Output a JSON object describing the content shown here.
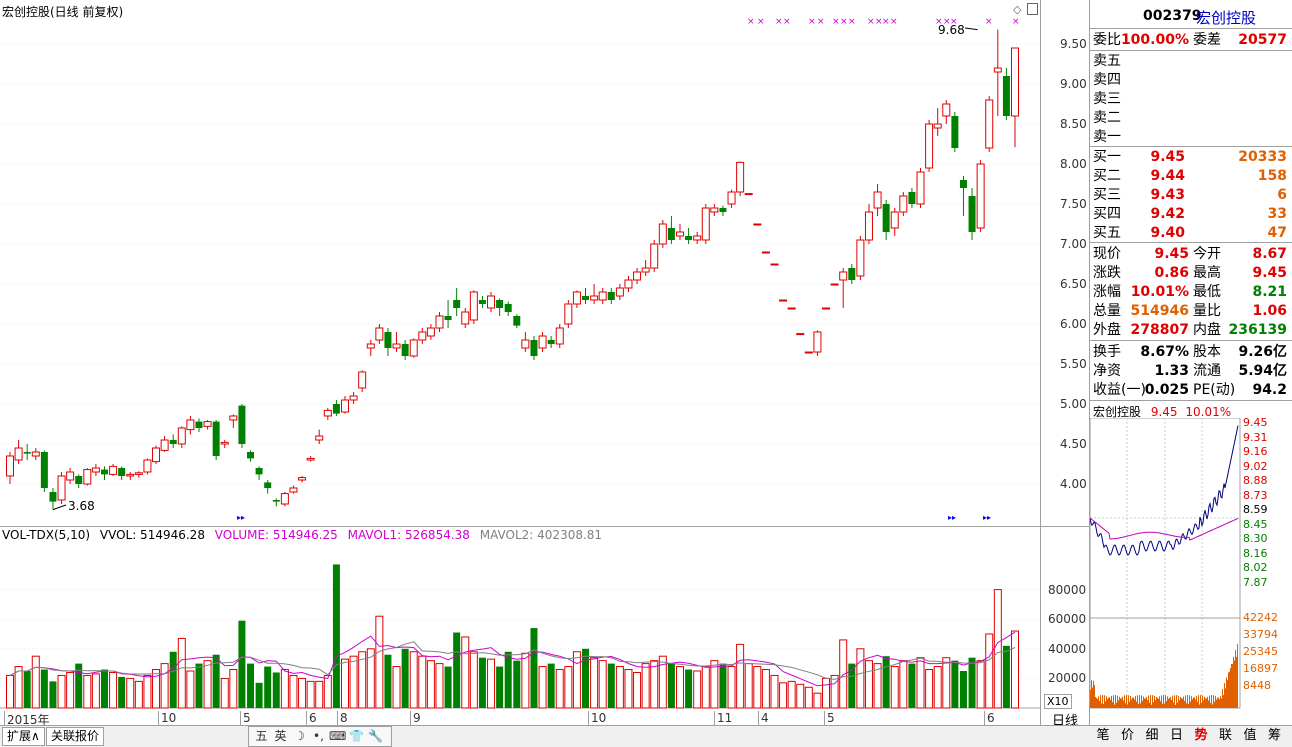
{
  "chart": {
    "title": "宏创控股(日线 前复权)",
    "high_label": "9.68",
    "low_label": "3.68",
    "price_axis": [
      "9.50",
      "9.00",
      "8.50",
      "8.00",
      "7.50",
      "7.00",
      "6.50",
      "6.00",
      "5.50",
      "5.00",
      "4.50",
      "4.00"
    ],
    "vol_axis": [
      "80000",
      "60000",
      "40000",
      "20000"
    ],
    "vol_unit": "X10",
    "period_label": "日线",
    "x_labels": [
      "2015年",
      "10",
      "5",
      "6",
      "8",
      "9",
      "10",
      "11",
      "4",
      "5",
      "6"
    ],
    "indicator": {
      "name": "VOL-TDX(5,10)",
      "vvol": "VVOL: 514946.28",
      "volume": "VOLUME: 514946.25",
      "mavol1": "MAVOL1: 526854.38",
      "mavol2": "MAVOL2: 402308.81"
    }
  },
  "chart_data": {
    "type": "candlestick",
    "y_range": [
      3.55,
      9.8
    ],
    "candles": [
      [
        4.1,
        4.35,
        4.0,
        4.4
      ],
      [
        4.3,
        4.45,
        4.25,
        4.55
      ],
      [
        4.4,
        4.38,
        4.3,
        4.5
      ],
      [
        4.35,
        4.4,
        4.3,
        4.45
      ],
      [
        4.4,
        3.95,
        3.9,
        4.42
      ],
      [
        3.9,
        3.78,
        3.68,
        3.95
      ],
      [
        3.8,
        4.1,
        3.75,
        4.15
      ],
      [
        4.05,
        4.15,
        4.0,
        4.2
      ],
      [
        4.1,
        4.0,
        3.95,
        4.12
      ],
      [
        4.0,
        4.18,
        3.98,
        4.2
      ],
      [
        4.15,
        4.2,
        4.1,
        4.25
      ],
      [
        4.18,
        4.12,
        4.05,
        4.22
      ],
      [
        4.12,
        4.22,
        4.1,
        4.25
      ],
      [
        4.2,
        4.1,
        4.05,
        4.22
      ],
      [
        4.1,
        4.12,
        4.05,
        4.15
      ],
      [
        4.12,
        4.14,
        4.08,
        4.16
      ],
      [
        4.15,
        4.3,
        4.12,
        4.32
      ],
      [
        4.28,
        4.45,
        4.25,
        4.48
      ],
      [
        4.42,
        4.55,
        4.4,
        4.6
      ],
      [
        4.55,
        4.5,
        4.45,
        4.62
      ],
      [
        4.5,
        4.7,
        4.45,
        4.72
      ],
      [
        4.68,
        4.8,
        4.62,
        4.85
      ],
      [
        4.78,
        4.7,
        4.65,
        4.82
      ],
      [
        4.72,
        4.78,
        4.68,
        4.8
      ],
      [
        4.78,
        4.35,
        4.3,
        4.8
      ],
      [
        4.5,
        4.52,
        4.45,
        4.55
      ],
      [
        4.8,
        4.85,
        4.7,
        4.87
      ],
      [
        4.98,
        4.5,
        4.45,
        5.0
      ],
      [
        4.4,
        4.32,
        4.28,
        4.42
      ],
      [
        4.2,
        4.12,
        4.05,
        4.22
      ],
      [
        4.02,
        3.95,
        3.88,
        4.05
      ],
      [
        3.8,
        3.78,
        3.72,
        3.82
      ],
      [
        3.75,
        3.88,
        3.72,
        3.9
      ],
      [
        3.9,
        3.95,
        3.88,
        3.98
      ],
      [
        4.05,
        4.08,
        4.02,
        4.1
      ],
      [
        4.3,
        4.32,
        4.28,
        4.35
      ],
      [
        4.55,
        4.6,
        4.5,
        4.68
      ],
      [
        4.85,
        4.92,
        4.8,
        4.95
      ],
      [
        5.0,
        4.88,
        4.85,
        5.05
      ],
      [
        4.9,
        5.05,
        4.88,
        5.1
      ],
      [
        5.05,
        5.1,
        5.0,
        5.15
      ],
      [
        5.2,
        5.4,
        5.15,
        5.42
      ],
      [
        5.7,
        5.75,
        5.6,
        5.8
      ],
      [
        5.8,
        5.95,
        5.75,
        6.0
      ],
      [
        5.9,
        5.7,
        5.6,
        5.95
      ],
      [
        5.7,
        5.75,
        5.65,
        5.9
      ],
      [
        5.75,
        5.6,
        5.55,
        5.8
      ],
      [
        5.6,
        5.8,
        5.58,
        5.82
      ],
      [
        5.8,
        5.9,
        5.75,
        5.95
      ],
      [
        5.85,
        5.95,
        5.8,
        6.0
      ],
      [
        5.95,
        6.1,
        5.9,
        6.15
      ],
      [
        6.1,
        6.05,
        5.95,
        6.3
      ],
      [
        6.3,
        6.2,
        6.1,
        6.45
      ],
      [
        6.0,
        6.15,
        5.95,
        6.2
      ],
      [
        6.05,
        6.4,
        6.0,
        6.42
      ],
      [
        6.3,
        6.25,
        6.2,
        6.35
      ],
      [
        6.2,
        6.35,
        6.15,
        6.4
      ],
      [
        6.3,
        6.2,
        6.1,
        6.32
      ],
      [
        6.25,
        6.15,
        6.1,
        6.28
      ],
      [
        6.1,
        5.98,
        5.95,
        6.12
      ],
      [
        5.7,
        5.8,
        5.65,
        5.9
      ],
      [
        5.8,
        5.6,
        5.55,
        5.85
      ],
      [
        5.7,
        5.85,
        5.65,
        5.9
      ],
      [
        5.8,
        5.75,
        5.7,
        5.85
      ],
      [
        5.75,
        5.95,
        5.7,
        6.0
      ],
      [
        6.0,
        6.25,
        5.95,
        6.3
      ],
      [
        6.25,
        6.4,
        6.2,
        6.42
      ],
      [
        6.35,
        6.3,
        6.25,
        6.45
      ],
      [
        6.3,
        6.35,
        6.25,
        6.5
      ],
      [
        6.3,
        6.4,
        6.25,
        6.45
      ],
      [
        6.4,
        6.3,
        6.25,
        6.45
      ],
      [
        6.35,
        6.45,
        6.3,
        6.5
      ],
      [
        6.45,
        6.55,
        6.4,
        6.6
      ],
      [
        6.55,
        6.65,
        6.5,
        6.7
      ],
      [
        6.65,
        6.7,
        6.6,
        6.8
      ],
      [
        6.7,
        7.0,
        6.65,
        7.05
      ],
      [
        7.0,
        7.25,
        6.95,
        7.3
      ],
      [
        7.2,
        7.05,
        7.0,
        7.35
      ],
      [
        7.1,
        7.15,
        7.05,
        7.25
      ],
      [
        7.1,
        7.05,
        7.0,
        7.2
      ],
      [
        7.05,
        7.1,
        7.0,
        7.15
      ],
      [
        7.05,
        7.45,
        7.0,
        7.5
      ],
      [
        7.4,
        7.45,
        7.35,
        7.5
      ],
      [
        7.45,
        7.4,
        7.35,
        7.48
      ],
      [
        7.5,
        7.65,
        7.45,
        7.68
      ],
      [
        7.65,
        8.02,
        7.6,
        8.03
      ],
      [
        7.63,
        7.63,
        7.63,
        7.63
      ],
      [
        7.25,
        7.25,
        7.25,
        7.25
      ],
      [
        6.9,
        6.9,
        6.9,
        6.9
      ],
      [
        6.75,
        6.75,
        6.75,
        6.75
      ],
      [
        6.3,
        6.3,
        6.3,
        6.3
      ],
      [
        6.2,
        6.2,
        6.2,
        6.2
      ],
      [
        5.88,
        5.88,
        5.88,
        5.88
      ],
      [
        5.65,
        5.65,
        5.65,
        5.65
      ],
      [
        5.65,
        5.9,
        5.6,
        5.92
      ],
      [
        6.2,
        6.2,
        6.2,
        6.2
      ],
      [
        6.5,
        6.5,
        6.5,
        6.5
      ],
      [
        6.55,
        6.65,
        6.2,
        6.7
      ],
      [
        6.7,
        6.55,
        6.5,
        6.75
      ],
      [
        6.6,
        7.05,
        6.55,
        7.1
      ],
      [
        7.05,
        7.4,
        7.0,
        7.5
      ],
      [
        7.45,
        7.65,
        7.35,
        7.75
      ],
      [
        7.5,
        7.15,
        7.05,
        7.55
      ],
      [
        7.2,
        7.4,
        7.1,
        7.45
      ],
      [
        7.4,
        7.6,
        7.35,
        7.65
      ],
      [
        7.65,
        7.5,
        7.45,
        7.7
      ],
      [
        7.5,
        7.9,
        7.45,
        7.95
      ],
      [
        7.95,
        8.5,
        7.9,
        8.55
      ],
      [
        8.45,
        8.5,
        8.35,
        8.7
      ],
      [
        8.6,
        8.75,
        8.5,
        8.8
      ],
      [
        8.6,
        8.2,
        8.15,
        8.65
      ],
      [
        7.8,
        7.7,
        7.35,
        7.85
      ],
      [
        7.6,
        7.15,
        7.05,
        7.7
      ],
      [
        7.2,
        8.0,
        7.15,
        8.05
      ],
      [
        8.2,
        8.8,
        8.15,
        8.85
      ],
      [
        9.15,
        9.2,
        8.6,
        9.68
      ],
      [
        9.1,
        8.6,
        8.55,
        9.2
      ],
      [
        8.6,
        9.45,
        8.21,
        9.45
      ]
    ],
    "volume": [
      22000,
      28000,
      25000,
      35000,
      26000,
      18000,
      22000,
      24000,
      30000,
      22000,
      23000,
      26000,
      24000,
      21000,
      20000,
      18000,
      22000,
      26000,
      30000,
      38000,
      47000,
      25000,
      30000,
      32000,
      36000,
      20000,
      26000,
      59000,
      30000,
      17000,
      28000,
      24000,
      26000,
      22000,
      20000,
      18000,
      18000,
      22000,
      97000,
      33000,
      35000,
      38000,
      40000,
      62000,
      36000,
      28000,
      40000,
      38000,
      35000,
      32000,
      30000,
      28000,
      51000,
      48000,
      38000,
      34000,
      33000,
      28000,
      38000,
      32000,
      37000,
      54000,
      28000,
      30000,
      26000,
      28000,
      38000,
      40000,
      34000,
      32000,
      30000,
      28000,
      26000,
      24000,
      30000,
      32000,
      35000,
      30000,
      28000,
      26000,
      25000,
      28000,
      32000,
      30000,
      28000,
      43000,
      30000,
      28000,
      26000,
      22000,
      17000,
      18000,
      16000,
      14000,
      10000,
      20000,
      22000,
      46000,
      30000,
      40000,
      32000,
      30000,
      35000,
      28000,
      32000,
      30000,
      34000,
      26000,
      28000,
      34000,
      32000,
      25000,
      34000,
      32000,
      50000,
      80000,
      42000,
      52000
    ]
  },
  "quote": {
    "code": "002379",
    "name": "宏创控股",
    "weibi_label": "委比",
    "weibi_value": "100.00%",
    "weicha_label": "委差",
    "weicha_value": "20577",
    "sell": [
      {
        "label": "卖五",
        "price": "",
        "vol": ""
      },
      {
        "label": "卖四",
        "price": "",
        "vol": ""
      },
      {
        "label": "卖三",
        "price": "",
        "vol": ""
      },
      {
        "label": "卖二",
        "price": "",
        "vol": ""
      },
      {
        "label": "卖一",
        "price": "",
        "vol": ""
      }
    ],
    "buy": [
      {
        "label": "买一",
        "price": "9.45",
        "vol": "20333"
      },
      {
        "label": "买二",
        "price": "9.44",
        "vol": "158"
      },
      {
        "label": "买三",
        "price": "9.43",
        "vol": "6"
      },
      {
        "label": "买四",
        "price": "9.42",
        "vol": "33"
      },
      {
        "label": "买五",
        "price": "9.40",
        "vol": "47"
      }
    ],
    "stats": [
      {
        "l1": "现价",
        "v1": "9.45",
        "l2": "今开",
        "v2": "8.67"
      },
      {
        "l1": "涨跌",
        "v1": "0.86",
        "l2": "最高",
        "v2": "9.45"
      },
      {
        "l1": "涨幅",
        "v1": "10.01%",
        "l2": "最低",
        "v2": "8.21"
      },
      {
        "l1": "总量",
        "v1": "514946",
        "l2": "量比",
        "v2": "1.06"
      },
      {
        "l1": "外盘",
        "v1": "278807",
        "l2": "内盘",
        "v2": "236139"
      }
    ],
    "fund": [
      {
        "l1": "换手",
        "v1": "8.67%",
        "l2": "股本",
        "v2": "9.26亿"
      },
      {
        "l1": "净资",
        "v1": "1.33",
        "l2": "流通",
        "v2": "5.94亿"
      },
      {
        "l1": "收益(一)",
        "v1": "0.025",
        "l2": "PE(动)",
        "v2": "94.2"
      }
    ]
  },
  "mini": {
    "title": "宏创控股",
    "price": "9.45",
    "pct": "10.01%",
    "price_axis": [
      "9.45",
      "9.31",
      "9.16",
      "9.02",
      "8.88",
      "8.73",
      "8.59",
      "8.45",
      "8.30",
      "8.16",
      "8.02",
      "7.87"
    ],
    "vol_axis": [
      "42242",
      "33794",
      "25345",
      "16897",
      "8448"
    ]
  },
  "bottom": {
    "tab1": "扩展∧",
    "tab2": "关联报价",
    "ime_items": [
      "五",
      "英",
      "☽",
      "•,",
      "⌨",
      "👕",
      "🔧"
    ],
    "right_tabs": [
      "笔",
      "价",
      "细",
      "日",
      "势",
      "联",
      "值",
      "筹"
    ]
  }
}
